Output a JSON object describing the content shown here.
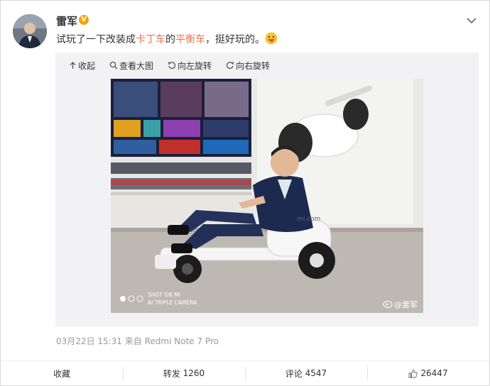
{
  "post": {
    "author": "雷军",
    "verified_badge": "V",
    "text_parts": [
      "试玩了一下改装成",
      "卡丁车",
      "的",
      "平衡车",
      "，挺好玩的。"
    ],
    "highlight_color": "#eb7350"
  },
  "toolbar": {
    "collapse": "收起",
    "view_large": "查看大图",
    "rotate_left": "向左旋转",
    "rotate_right": "向右旋转"
  },
  "photo": {
    "shot_on_line1": "SHOT ON MI",
    "shot_on_line2": "AI TRIPLE CAMERA",
    "store_sign": "mi.com",
    "watermark": "@雷军"
  },
  "meta": {
    "timestamp": "03月22日 15:31",
    "source_prefix": "来自",
    "source": "Redmi Note 7 Pro"
  },
  "actions": {
    "favorite": "收藏",
    "repost_label": "转发",
    "repost_count": "1260",
    "comment_label": "评论",
    "comment_count": "4547",
    "like_count": "26447"
  },
  "icons": [
    "chevron-down-icon",
    "emoji-icon",
    "collapse-arrow-icon",
    "magnifier-icon",
    "rotate-left-icon",
    "rotate-right-icon",
    "thumbs-up-icon",
    "weibo-logo-icon"
  ],
  "colors": {
    "badge": "#f7a20a",
    "media_bg": "#f2f2f5"
  }
}
